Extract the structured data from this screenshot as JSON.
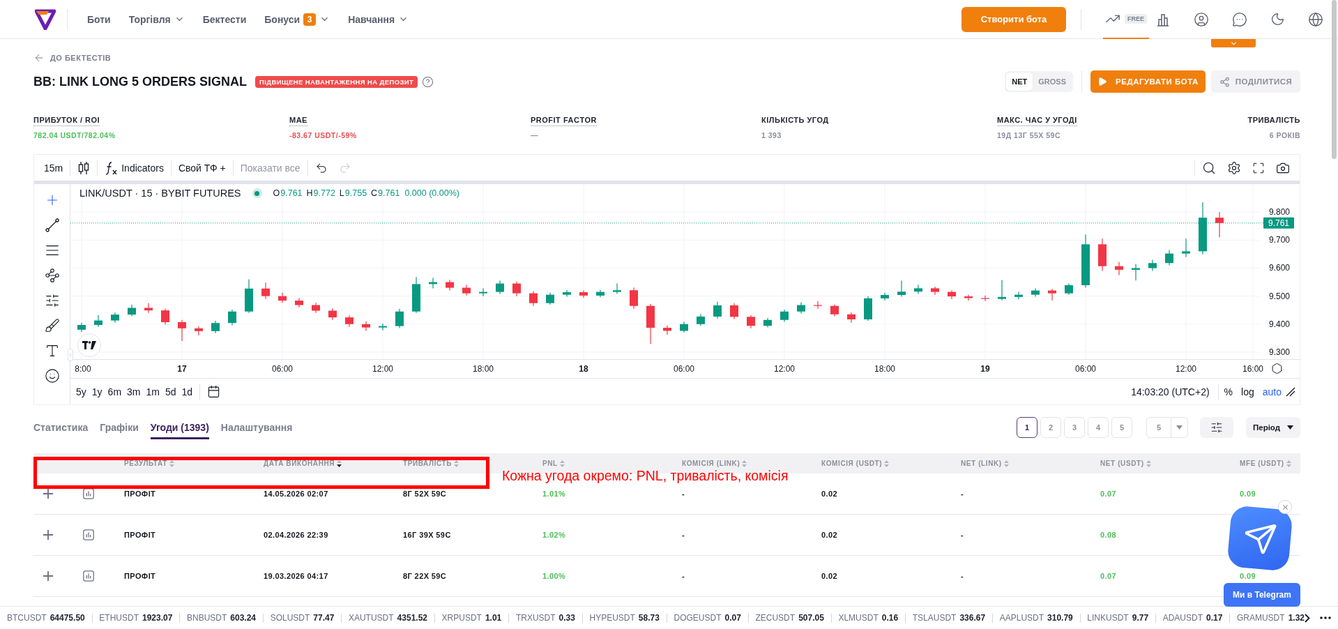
{
  "nav": {
    "items": [
      {
        "label": "Боти",
        "dropdown": false
      },
      {
        "label": "Торгівля",
        "dropdown": true
      },
      {
        "label": "Бектести",
        "dropdown": false
      },
      {
        "label": "Бонуси",
        "badge": "3",
        "dropdown": true
      },
      {
        "label": "Навчання",
        "dropdown": true
      }
    ],
    "create_button": "Створити бота",
    "plan_tab": {
      "badge": "FREE",
      "selected": true
    }
  },
  "back_link": "ДО БЕКТЕСТІВ",
  "title": "BB: LINK LONG 5 ORDERS SIGNAL",
  "warning_badge": "ПІДВИЩЕНЕ НАВАНТАЖЕННЯ НА ДЕПОЗИТ",
  "mode_toggle": [
    {
      "label": "NET",
      "selected": true
    },
    {
      "label": "GROSS",
      "selected": false
    }
  ],
  "edit_button": "РЕДАГУВАТИ БОТА",
  "share_button": "ПОДІЛИТИСЯ",
  "stats": [
    {
      "label": "ПРИБУТОК / ROI",
      "value": "782.04 USDT/782.04%",
      "color": "#4cbf58",
      "dotted": true
    },
    {
      "label": "MAE",
      "value": "-83.67 USDT/-59%",
      "color": "#ef4b4b",
      "dotted": true
    },
    {
      "label": "PROFIT FACTOR",
      "value": "—",
      "color": "#8b8f9c",
      "dotted": true
    },
    {
      "label": "КІЛЬКІСТЬ УГОД",
      "value": "1 393",
      "color": "#8b8f9c",
      "dotted": false
    },
    {
      "label": "МАКС. ЧАС У УГОДІ",
      "value": "19Д 13Г 55Х 59С",
      "color": "#8b8f9c",
      "dotted": true
    },
    {
      "label": "ТРИВАЛІСТЬ",
      "value": "6 РОКІВ",
      "color": "#8b8f9c",
      "dotted": false
    }
  ],
  "chart": {
    "toolbar": {
      "interval": "15m",
      "indicators": "Indicators",
      "custom_tf": "Свой ТФ +",
      "show_all": {
        "label": "Показати все",
        "disabled": true
      },
      "redo": {
        "disabled": true
      }
    },
    "drawing_tools": [
      {
        "kind": "crosshair",
        "selected": true
      },
      {
        "kind": "line",
        "selected": false
      },
      {
        "kind": "lines",
        "selected": false
      },
      {
        "kind": "pattern",
        "selected": false
      },
      {
        "kind": "sliders",
        "selected": false
      },
      {
        "kind": "brush",
        "selected": false
      },
      {
        "kind": "text",
        "selected": false
      },
      {
        "kind": "emoji",
        "selected": false
      }
    ],
    "legend": {
      "symbol": "LINK/USDT · 15 · BYBIT FUTURES",
      "ohlc": [
        {
          "label": "O",
          "value": "9.761"
        },
        {
          "label": "H",
          "value": "9.772"
        },
        {
          "label": "L",
          "value": "9.755"
        },
        {
          "label": "C",
          "value": "9.761"
        }
      ],
      "change": "0.000 (0.00%)"
    },
    "chart_data": {
      "type": "candlestick",
      "ylim": [
        9.275,
        9.9
      ],
      "grid": true,
      "ref_lines": [
        {
          "axis": "y",
          "value": 9.761,
          "label": "9.761",
          "color": "#089981"
        }
      ],
      "yticks": [
        {
          "value": 9.8,
          "label": "9.800"
        },
        {
          "value": 9.7,
          "label": "9.700"
        },
        {
          "value": 9.6,
          "label": "9.600"
        },
        {
          "value": 9.5,
          "label": "9.500"
        },
        {
          "value": 9.4,
          "label": "9.400"
        },
        {
          "value": 9.3,
          "label": "9.300"
        }
      ],
      "categories": [
        "8:00",
        null,
        null,
        null,
        null,
        null,
        "17",
        null,
        null,
        null,
        null,
        null,
        "06:00",
        null,
        null,
        null,
        null,
        null,
        "12:00",
        null,
        null,
        null,
        null,
        null,
        "18:00",
        null,
        null,
        null,
        null,
        null,
        "18",
        null,
        null,
        null,
        null,
        null,
        "06:00",
        null,
        null,
        null,
        null,
        null,
        "12:00",
        null,
        null,
        null,
        null,
        null,
        "18:00",
        null,
        null,
        null,
        null,
        null,
        "19",
        null,
        null,
        null,
        null,
        null,
        "06:00",
        null,
        null,
        null,
        null,
        null,
        "12:00",
        null,
        null,
        null,
        "16:00"
      ],
      "ohlc": [
        [
          9.38,
          9.405,
          9.372,
          9.397
        ],
        [
          9.397,
          9.432,
          9.39,
          9.413
        ],
        [
          9.413,
          9.441,
          9.405,
          9.434
        ],
        [
          9.434,
          9.47,
          9.428,
          9.458
        ],
        [
          9.458,
          9.475,
          9.44,
          9.449
        ],
        [
          9.449,
          9.455,
          9.398,
          9.407
        ],
        [
          9.407,
          9.415,
          9.34,
          9.385
        ],
        [
          9.385,
          9.392,
          9.36,
          9.375
        ],
        [
          9.375,
          9.412,
          9.368,
          9.404
        ],
        [
          9.404,
          9.452,
          9.396,
          9.445
        ],
        [
          9.445,
          9.56,
          9.44,
          9.527
        ],
        [
          9.527,
          9.548,
          9.49,
          9.5
        ],
        [
          9.5,
          9.512,
          9.476,
          9.484
        ],
        [
          9.484,
          9.493,
          9.46,
          9.468
        ],
        [
          9.468,
          9.476,
          9.44,
          9.448
        ],
        [
          9.448,
          9.456,
          9.415,
          9.424
        ],
        [
          9.424,
          9.431,
          9.39,
          9.4
        ],
        [
          9.4,
          9.41,
          9.376,
          9.388
        ],
        [
          9.388,
          9.402,
          9.378,
          9.393
        ],
        [
          9.393,
          9.455,
          9.386,
          9.445
        ],
        [
          9.445,
          9.568,
          9.44,
          9.543
        ],
        [
          9.543,
          9.565,
          9.528,
          9.55
        ],
        [
          9.55,
          9.558,
          9.52,
          9.53
        ],
        [
          9.53,
          9.54,
          9.502,
          9.51
        ],
        [
          9.51,
          9.528,
          9.5,
          9.515
        ],
        [
          9.515,
          9.556,
          9.508,
          9.545
        ],
        [
          9.545,
          9.552,
          9.5,
          9.51
        ],
        [
          9.51,
          9.518,
          9.465,
          9.475
        ],
        [
          9.475,
          9.512,
          9.47,
          9.505
        ],
        [
          9.505,
          9.522,
          9.498,
          9.514
        ],
        [
          9.514,
          9.52,
          9.494,
          9.502
        ],
        [
          9.502,
          9.522,
          9.496,
          9.515
        ],
        [
          9.515,
          9.545,
          9.508,
          9.521
        ],
        [
          9.521,
          9.53,
          9.455,
          9.465
        ],
        [
          9.465,
          9.472,
          9.33,
          9.387
        ],
        [
          9.387,
          9.395,
          9.362,
          9.376
        ],
        [
          9.376,
          9.408,
          9.37,
          9.4
        ],
        [
          9.4,
          9.436,
          9.394,
          9.427
        ],
        [
          9.427,
          9.48,
          9.42,
          9.467
        ],
        [
          9.467,
          9.474,
          9.418,
          9.426
        ],
        [
          9.426,
          9.432,
          9.385,
          9.394
        ],
        [
          9.394,
          9.422,
          9.388,
          9.415
        ],
        [
          9.415,
          9.452,
          9.408,
          9.445
        ],
        [
          9.445,
          9.478,
          9.438,
          9.468
        ],
        [
          9.468,
          9.482,
          9.455,
          9.465
        ],
        [
          9.465,
          9.47,
          9.428,
          9.435
        ],
        [
          9.435,
          9.442,
          9.405,
          9.417
        ],
        [
          9.417,
          9.5,
          9.412,
          9.492
        ],
        [
          9.492,
          9.512,
          9.485,
          9.504
        ],
        [
          9.504,
          9.555,
          9.498,
          9.516
        ],
        [
          9.516,
          9.54,
          9.508,
          9.528
        ],
        [
          9.528,
          9.534,
          9.505,
          9.515
        ],
        [
          9.515,
          9.521,
          9.49,
          9.499
        ],
        [
          9.499,
          9.505,
          9.484,
          9.493
        ],
        [
          9.493,
          9.502,
          9.482,
          9.49
        ],
        [
          9.49,
          9.557,
          9.485,
          9.497
        ],
        [
          9.497,
          9.515,
          9.488,
          9.505
        ],
        [
          9.505,
          9.528,
          9.498,
          9.52
        ],
        [
          9.52,
          9.526,
          9.485,
          9.51
        ],
        [
          9.51,
          9.545,
          9.505,
          9.539
        ],
        [
          9.539,
          9.72,
          9.53,
          9.685
        ],
        [
          9.685,
          9.705,
          9.59,
          9.607
        ],
        [
          9.607,
          9.622,
          9.575,
          9.594
        ],
        [
          9.594,
          9.615,
          9.556,
          9.6
        ],
        [
          9.6,
          9.63,
          9.59,
          9.618
        ],
        [
          9.618,
          9.665,
          9.61,
          9.652
        ],
        [
          9.652,
          9.705,
          9.64,
          9.66
        ],
        [
          9.66,
          9.835,
          9.65,
          9.78
        ],
        [
          9.78,
          9.8,
          9.71,
          9.761
        ],
        null,
        null
      ]
    },
    "time_label_bold": [
      false,
      true,
      false,
      false,
      false,
      true,
      false,
      false,
      false,
      true,
      false,
      false,
      false
    ],
    "ranges": [
      "5y",
      "1y",
      "6m",
      "3m",
      "1m",
      "5d",
      "1d"
    ],
    "clock": "14:03:20 (UTC+2)",
    "scale_options": [
      {
        "label": "%",
        "selected": false
      },
      {
        "label": "log",
        "selected": false
      },
      {
        "label": "auto",
        "selected": true
      }
    ]
  },
  "tabs": [
    {
      "label": "Статистика",
      "selected": false
    },
    {
      "label": "Графіки",
      "selected": false
    },
    {
      "label": "Угоди (1393)",
      "selected": true
    },
    {
      "label": "Налаштування",
      "selected": false
    }
  ],
  "pagination": {
    "pages": [
      {
        "label": "1",
        "selected": true
      },
      {
        "label": "2",
        "selected": false
      },
      {
        "label": "3",
        "selected": false
      },
      {
        "label": "4",
        "selected": false
      },
      {
        "label": "5",
        "selected": false
      }
    ],
    "page_size": "5",
    "period": "Період"
  },
  "table": {
    "columns": [
      {
        "label": "РЕЗУЛЬТАТ",
        "kind": "plain",
        "sorted": false
      },
      {
        "label": "ДАТА ВИКОНАННЯ",
        "kind": "plain",
        "sorted": true
      },
      {
        "label": "ТРИВАЛІСТЬ",
        "kind": "plain",
        "sorted": false
      },
      {
        "label": "PNL",
        "kind": "gain",
        "sorted": false
      },
      {
        "label": "КОМІСІЯ (LINK)",
        "kind": "plain",
        "sorted": false
      },
      {
        "label": "КОМІСІЯ (USDT)",
        "kind": "plain",
        "sorted": false
      },
      {
        "label": "NET (LINK)",
        "kind": "plain",
        "sorted": false
      },
      {
        "label": "NET (USDT)",
        "kind": "gain",
        "sorted": false
      },
      {
        "label": "MFE (USDT)",
        "kind": "gain",
        "sorted": false
      }
    ],
    "rows": [
      {
        "cells": [
          "ПРОФІТ",
          "14.05.2026 02:07",
          "8Г 52Х 59С",
          "1.01%",
          "-",
          "0.02",
          "-",
          "0.07",
          "0.09"
        ]
      },
      {
        "cells": [
          "ПРОФІТ",
          "02.04.2026 22:39",
          "16Г 39Х 59С",
          "1.02%",
          "-",
          "0.02",
          "-",
          "0.08"
        ]
      },
      {
        "cells": [
          "ПРОФІТ",
          "19.03.2026 04:17",
          "8Г 22Х 59С",
          "1.00%",
          "-",
          "0.02",
          "-",
          "0.07",
          "0.09"
        ]
      }
    ]
  },
  "annotation": "Кожна угода окремо: PNL, тривалість, комісія",
  "telegram": {
    "button": "Ми в Telegram"
  },
  "ticker": [
    {
      "symbol": "BTCUSDT",
      "price": "64475.50"
    },
    {
      "symbol": "ETHUSDT",
      "price": "1923.07"
    },
    {
      "symbol": "BNBUSDT",
      "price": "603.24"
    },
    {
      "symbol": "SOLUSDT",
      "price": "77.47"
    },
    {
      "symbol": "XAUTUSDT",
      "price": "4351.52"
    },
    {
      "symbol": "XRPUSDT",
      "price": "1.01"
    },
    {
      "symbol": "TRXUSDT",
      "price": "0.33"
    },
    {
      "symbol": "HYPEUSDT",
      "price": "58.73"
    },
    {
      "symbol": "DOGEUSDT",
      "price": "0.07"
    },
    {
      "symbol": "ZECUSDT",
      "price": "507.05"
    },
    {
      "symbol": "XLMUSDT",
      "price": "0.16"
    },
    {
      "symbol": "TSLAUSDT",
      "price": "336.67"
    },
    {
      "symbol": "AAPLUSDT",
      "price": "310.79"
    },
    {
      "symbol": "LINKUSDT",
      "price": "9.77"
    },
    {
      "symbol": "ADAUSDT",
      "price": "0.17"
    },
    {
      "symbol": "GRAMUSDT",
      "price": "1.32"
    }
  ]
}
